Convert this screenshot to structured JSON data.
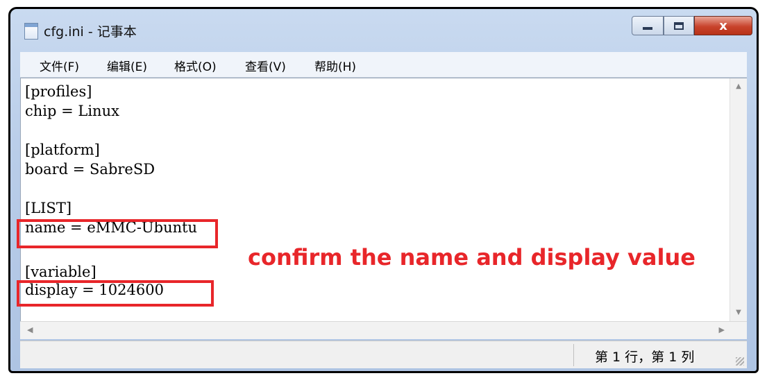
{
  "window": {
    "title": "cfg.ini - 记事本",
    "controls": {
      "minimize": "",
      "maximize": "",
      "close": "x"
    }
  },
  "menu": [
    "文件(F)",
    "编辑(E)",
    "格式(O)",
    "查看(V)",
    "帮助(H)"
  ],
  "editor": {
    "lines": [
      "[profiles]",
      "chip = Linux",
      "",
      "[platform]",
      "board = SabreSD",
      "",
      "[LIST]",
      "name = eMMC-Ubuntu",
      "",
      "[variable]",
      "display = 1024600"
    ]
  },
  "statusbar": {
    "position": "第 1 行，第 1 列"
  },
  "annotation": {
    "text": "confirm the name and display value",
    "color": "#e8262a"
  },
  "scrollbars": {
    "up": "▲",
    "down": "▼",
    "left": "◀",
    "right": "▶"
  }
}
